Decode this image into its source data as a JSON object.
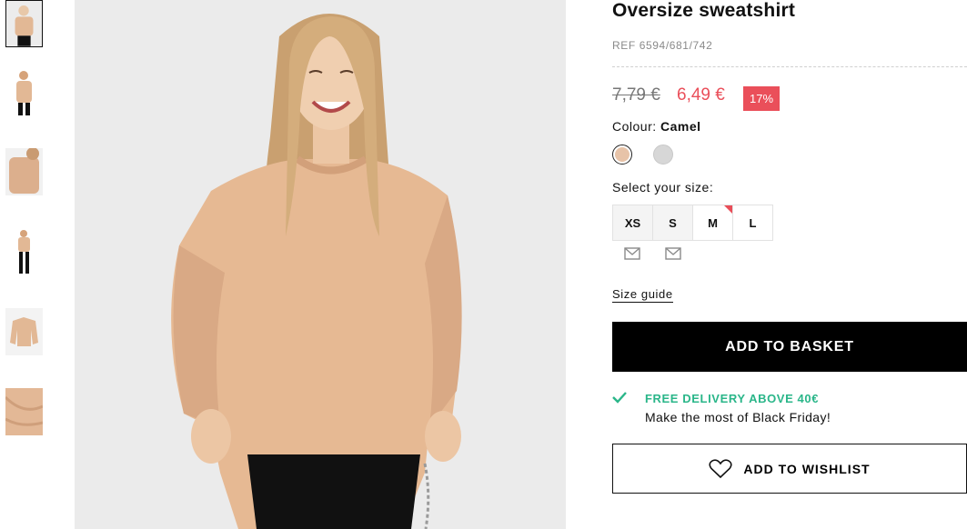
{
  "product": {
    "title": "Oversize sweatshirt",
    "ref": "REF 6594/681/742",
    "old_price": "7,79 €",
    "new_price": "6,49 €",
    "discount": "17%",
    "colour_label": "Colour:",
    "colour_value": "Camel",
    "size_label": "Select your size:",
    "sizes": [
      "XS",
      "S",
      "M",
      "L"
    ],
    "size_guide": "Size guide",
    "add_to_basket": "ADD TO BASKET",
    "delivery_title": "FREE DELIVERY ABOVE 40€",
    "delivery_sub": "Make the most of Black Friday!",
    "add_to_wishlist": "ADD TO WISHLIST"
  },
  "colors": {
    "sale_red": "#ea4f5a",
    "delivery_green": "#2ab689",
    "camel_swatch": "#e7c3a8",
    "grey_swatch": "#d7d7d7"
  },
  "icons": [
    "mail-icon",
    "check-icon",
    "heart-icon"
  ]
}
